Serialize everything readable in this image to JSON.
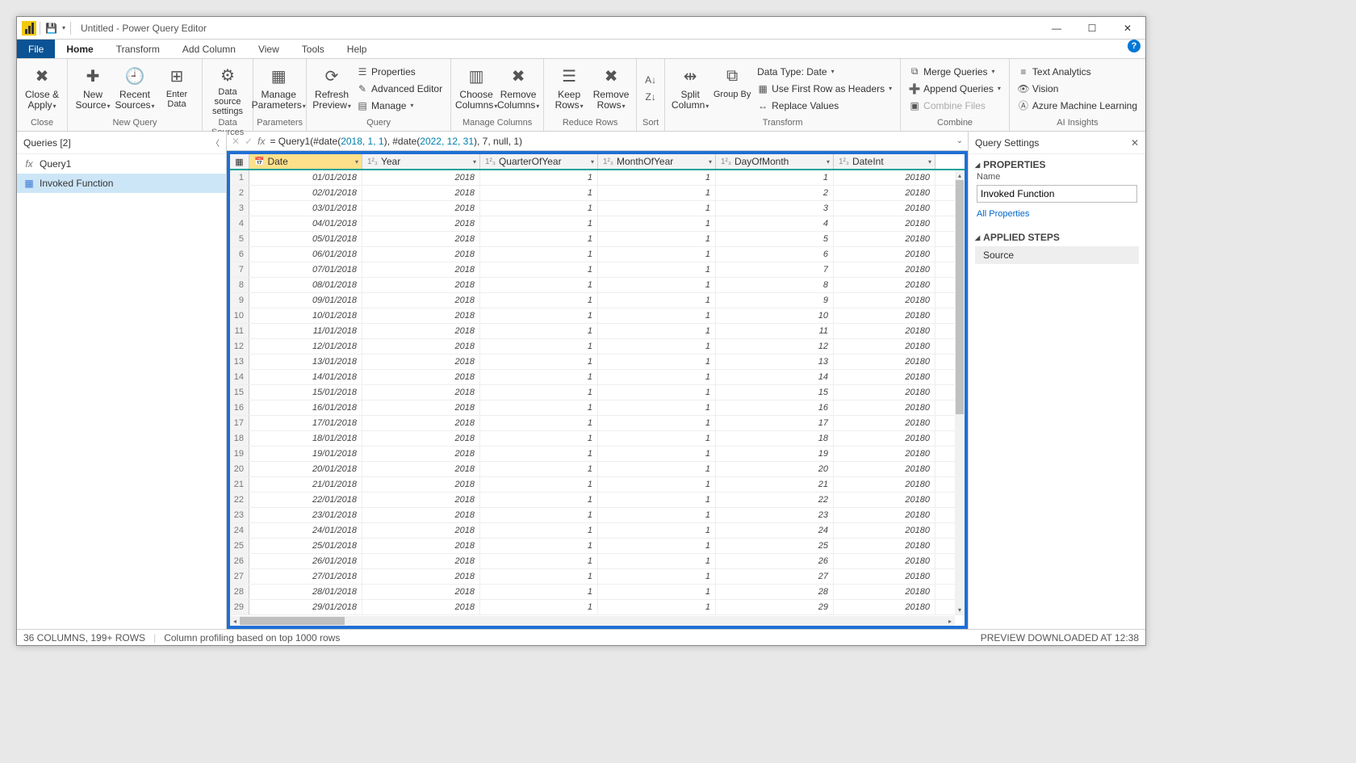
{
  "titlebar": {
    "title": "Untitled - Power Query Editor"
  },
  "tabs": {
    "file": "File",
    "home": "Home",
    "transform": "Transform",
    "addcolumn": "Add Column",
    "view": "View",
    "tools": "Tools",
    "help": "Help"
  },
  "ribbon": {
    "close": "Close & Apply",
    "closeGroup": "Close",
    "newSource": "New Source",
    "recent": "Recent Sources",
    "enter": "Enter Data",
    "newQuery": "New Query",
    "dsSettings": "Data source settings",
    "dsGroup": "Data Sources",
    "manageParams": "Manage Parameters",
    "paramsGroup": "Parameters",
    "refresh": "Refresh Preview",
    "props": "Properties",
    "adv": "Advanced Editor",
    "manage": "Manage",
    "queryGroup": "Query",
    "chooseCols": "Choose Columns",
    "removeCols": "Remove Columns",
    "mcGroup": "Manage Columns",
    "keepRows": "Keep Rows",
    "removeRows": "Remove Rows",
    "rrGroup": "Reduce Rows",
    "sortGroup": "Sort",
    "split": "Split Column",
    "groupBy": "Group By",
    "dtype": "Data Type: Date",
    "firstRow": "Use First Row as Headers",
    "replace": "Replace Values",
    "transformGroup": "Transform",
    "merge": "Merge Queries",
    "append": "Append Queries",
    "combineFiles": "Combine Files",
    "combineGroup": "Combine",
    "textan": "Text Analytics",
    "vision": "Vision",
    "aml": "Azure Machine Learning",
    "aiGroup": "AI Insights"
  },
  "queries": {
    "title": "Queries [2]",
    "q1": "Query1",
    "q2": "Invoked Function"
  },
  "formula": {
    "prefix": "= Query1(#date(",
    "a": "2018, 1, 1",
    "mid": "), #date(",
    "b": "2022, 12, 31",
    "suffix": "), 7, null, 1)"
  },
  "columns": {
    "date": "Date",
    "year": "Year",
    "qoy": "QuarterOfYear",
    "moy": "MonthOfYear",
    "dom": "DayOfMonth",
    "dint": "DateInt"
  },
  "rows": [
    {
      "n": 1,
      "d": "01/01/2018",
      "y": "2018",
      "q": "1",
      "m": "1",
      "day": "1",
      "di": "20180"
    },
    {
      "n": 2,
      "d": "02/01/2018",
      "y": "2018",
      "q": "1",
      "m": "1",
      "day": "2",
      "di": "20180"
    },
    {
      "n": 3,
      "d": "03/01/2018",
      "y": "2018",
      "q": "1",
      "m": "1",
      "day": "3",
      "di": "20180"
    },
    {
      "n": 4,
      "d": "04/01/2018",
      "y": "2018",
      "q": "1",
      "m": "1",
      "day": "4",
      "di": "20180"
    },
    {
      "n": 5,
      "d": "05/01/2018",
      "y": "2018",
      "q": "1",
      "m": "1",
      "day": "5",
      "di": "20180"
    },
    {
      "n": 6,
      "d": "06/01/2018",
      "y": "2018",
      "q": "1",
      "m": "1",
      "day": "6",
      "di": "20180"
    },
    {
      "n": 7,
      "d": "07/01/2018",
      "y": "2018",
      "q": "1",
      "m": "1",
      "day": "7",
      "di": "20180"
    },
    {
      "n": 8,
      "d": "08/01/2018",
      "y": "2018",
      "q": "1",
      "m": "1",
      "day": "8",
      "di": "20180"
    },
    {
      "n": 9,
      "d": "09/01/2018",
      "y": "2018",
      "q": "1",
      "m": "1",
      "day": "9",
      "di": "20180"
    },
    {
      "n": 10,
      "d": "10/01/2018",
      "y": "2018",
      "q": "1",
      "m": "1",
      "day": "10",
      "di": "20180"
    },
    {
      "n": 11,
      "d": "11/01/2018",
      "y": "2018",
      "q": "1",
      "m": "1",
      "day": "11",
      "di": "20180"
    },
    {
      "n": 12,
      "d": "12/01/2018",
      "y": "2018",
      "q": "1",
      "m": "1",
      "day": "12",
      "di": "20180"
    },
    {
      "n": 13,
      "d": "13/01/2018",
      "y": "2018",
      "q": "1",
      "m": "1",
      "day": "13",
      "di": "20180"
    },
    {
      "n": 14,
      "d": "14/01/2018",
      "y": "2018",
      "q": "1",
      "m": "1",
      "day": "14",
      "di": "20180"
    },
    {
      "n": 15,
      "d": "15/01/2018",
      "y": "2018",
      "q": "1",
      "m": "1",
      "day": "15",
      "di": "20180"
    },
    {
      "n": 16,
      "d": "16/01/2018",
      "y": "2018",
      "q": "1",
      "m": "1",
      "day": "16",
      "di": "20180"
    },
    {
      "n": 17,
      "d": "17/01/2018",
      "y": "2018",
      "q": "1",
      "m": "1",
      "day": "17",
      "di": "20180"
    },
    {
      "n": 18,
      "d": "18/01/2018",
      "y": "2018",
      "q": "1",
      "m": "1",
      "day": "18",
      "di": "20180"
    },
    {
      "n": 19,
      "d": "19/01/2018",
      "y": "2018",
      "q": "1",
      "m": "1",
      "day": "19",
      "di": "20180"
    },
    {
      "n": 20,
      "d": "20/01/2018",
      "y": "2018",
      "q": "1",
      "m": "1",
      "day": "20",
      "di": "20180"
    },
    {
      "n": 21,
      "d": "21/01/2018",
      "y": "2018",
      "q": "1",
      "m": "1",
      "day": "21",
      "di": "20180"
    },
    {
      "n": 22,
      "d": "22/01/2018",
      "y": "2018",
      "q": "1",
      "m": "1",
      "day": "22",
      "di": "20180"
    },
    {
      "n": 23,
      "d": "23/01/2018",
      "y": "2018",
      "q": "1",
      "m": "1",
      "day": "23",
      "di": "20180"
    },
    {
      "n": 24,
      "d": "24/01/2018",
      "y": "2018",
      "q": "1",
      "m": "1",
      "day": "24",
      "di": "20180"
    },
    {
      "n": 25,
      "d": "25/01/2018",
      "y": "2018",
      "q": "1",
      "m": "1",
      "day": "25",
      "di": "20180"
    },
    {
      "n": 26,
      "d": "26/01/2018",
      "y": "2018",
      "q": "1",
      "m": "1",
      "day": "26",
      "di": "20180"
    },
    {
      "n": 27,
      "d": "27/01/2018",
      "y": "2018",
      "q": "1",
      "m": "1",
      "day": "27",
      "di": "20180"
    },
    {
      "n": 28,
      "d": "28/01/2018",
      "y": "2018",
      "q": "1",
      "m": "1",
      "day": "28",
      "di": "20180"
    },
    {
      "n": 29,
      "d": "29/01/2018",
      "y": "2018",
      "q": "1",
      "m": "1",
      "day": "29",
      "di": "20180"
    }
  ],
  "settings": {
    "title": "Query Settings",
    "properties": "PROPERTIES",
    "nameLabel": "Name",
    "nameValue": "Invoked Function",
    "allProps": "All Properties",
    "applied": "APPLIED STEPS",
    "step1": "Source"
  },
  "status": {
    "left1": "36 COLUMNS, 199+ ROWS",
    "left2": "Column profiling based on top 1000 rows",
    "right": "PREVIEW DOWNLOADED AT 12:38"
  }
}
